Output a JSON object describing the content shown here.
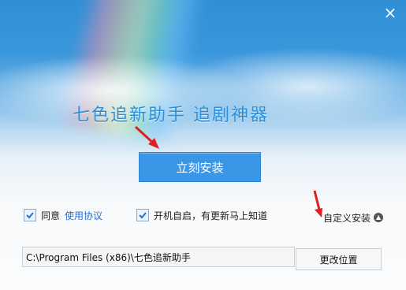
{
  "window": {
    "close_icon": "×",
    "headline": "七色追新助手   追剧神器"
  },
  "install": {
    "button_label": "立刻安装"
  },
  "options": {
    "agree_label": "同意",
    "agreement_link": "使用协议",
    "autostart_label": "开机自启，有更新马上知道",
    "custom_install_label": "自定义安装",
    "custom_install_icon": "▲"
  },
  "path": {
    "value": "C:\\Program Files (x86)\\七色追新助手",
    "change_button": "更改位置"
  },
  "colors": {
    "accent": "#3a96e6",
    "arrow": "#e02020",
    "link": "#2a6fc9"
  }
}
